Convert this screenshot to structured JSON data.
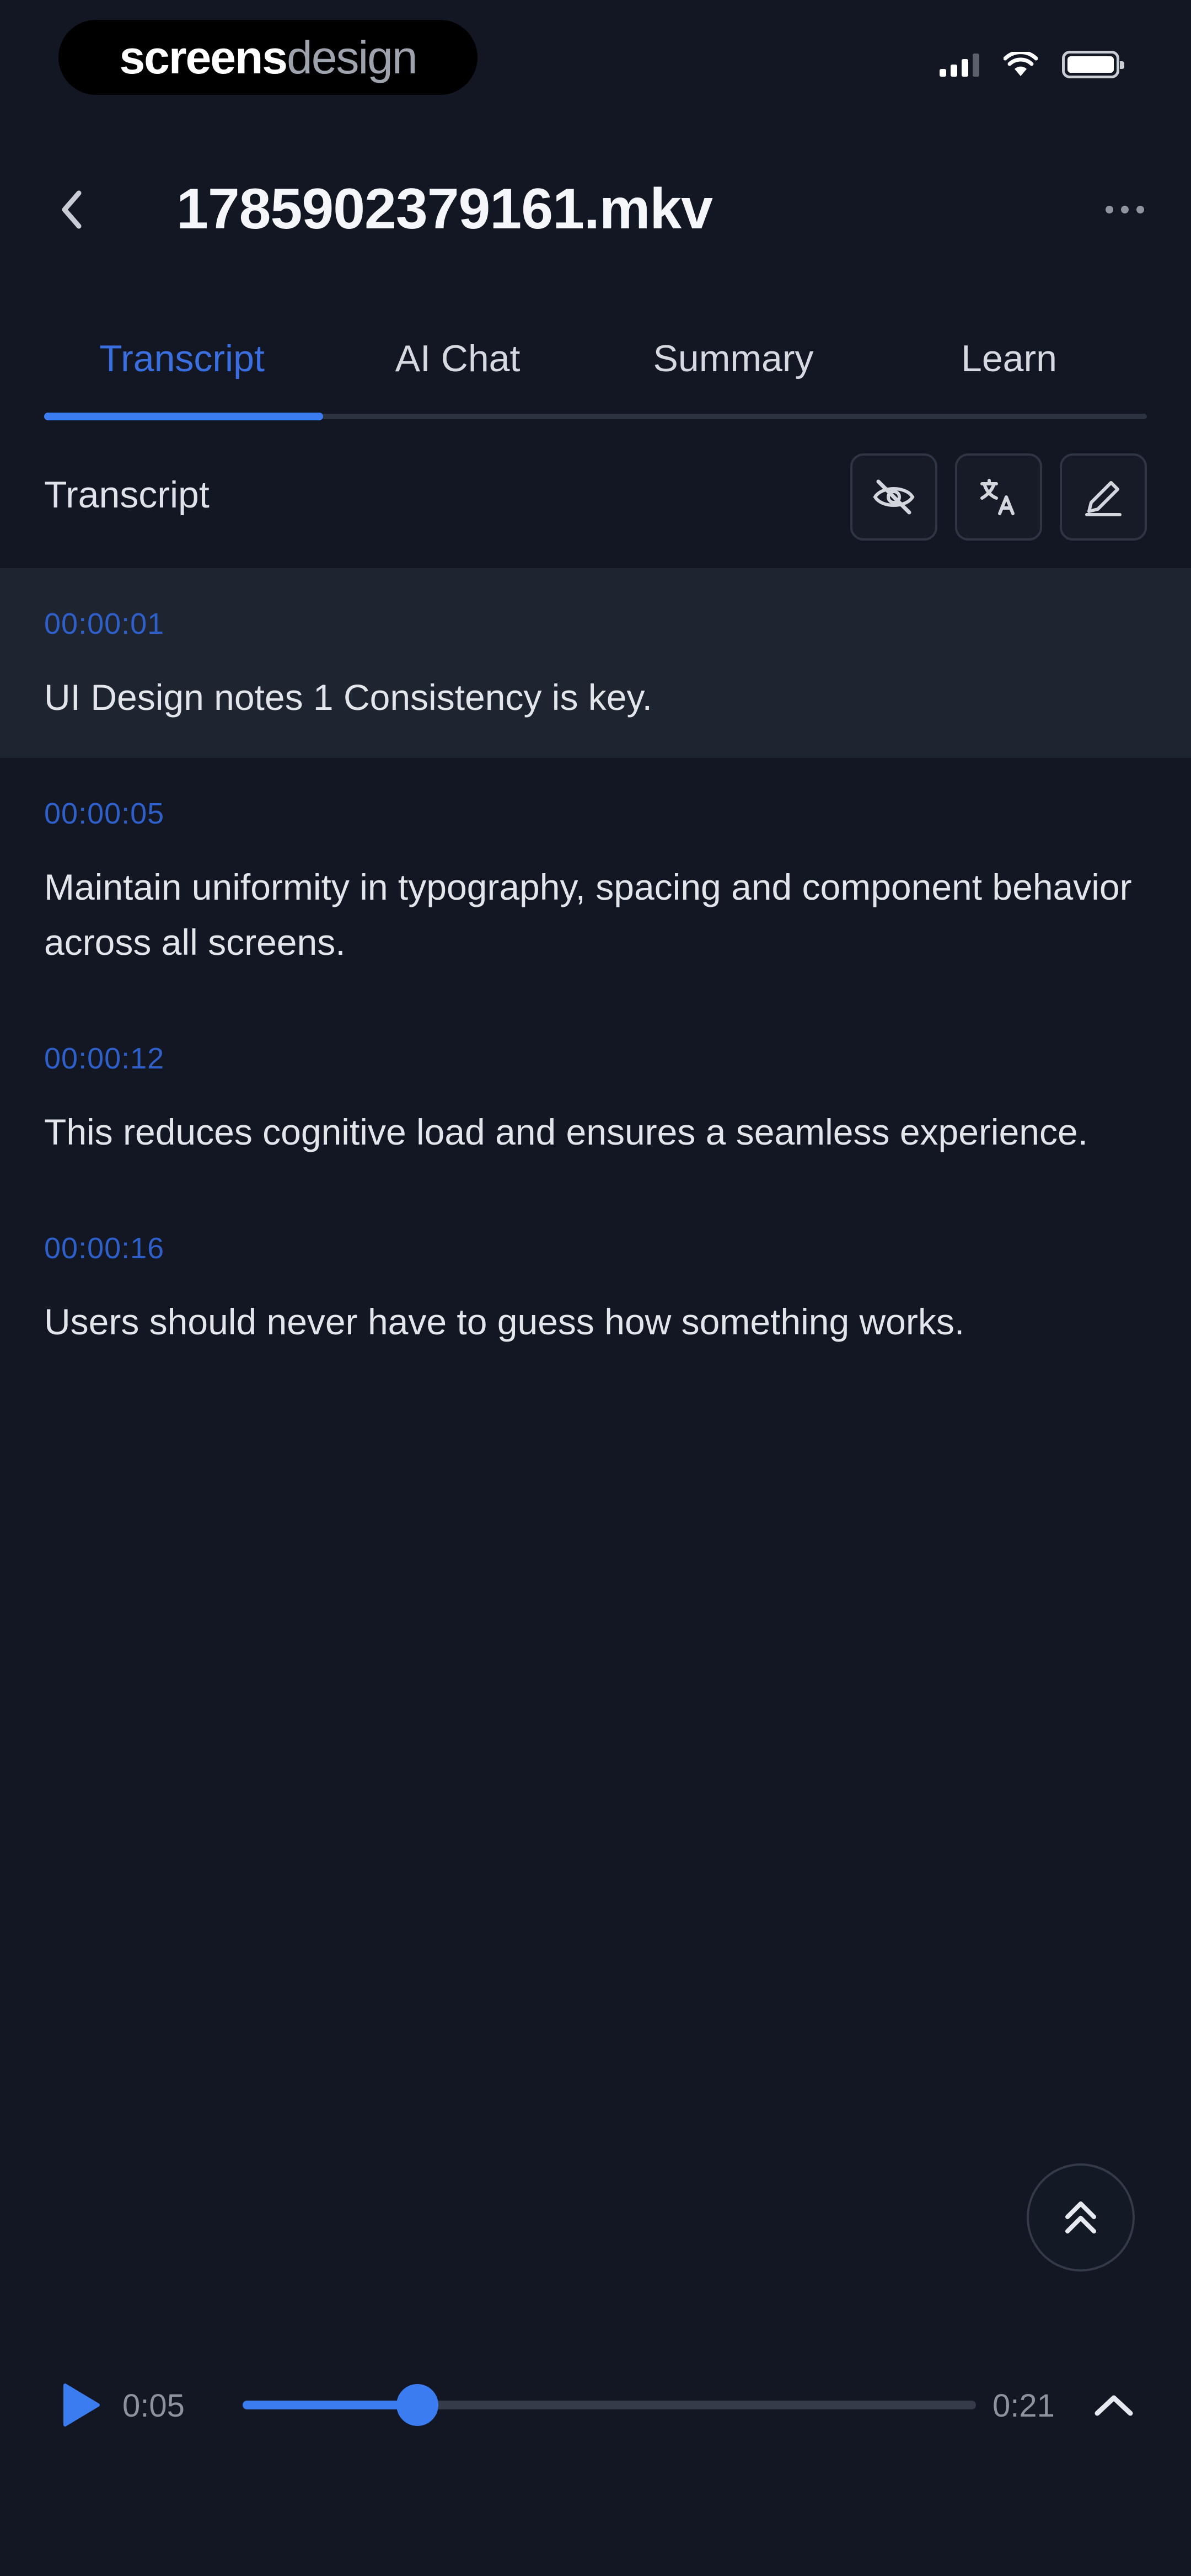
{
  "status_bar": {
    "brand_bold": "screens",
    "brand_light": "design",
    "icons": [
      "signal-icon",
      "wifi-icon",
      "battery-icon"
    ]
  },
  "header": {
    "title": "1785902379161.mkv",
    "icons": [
      "chevron-left-icon",
      "more-horizontal-icon"
    ]
  },
  "tabs": [
    {
      "label": "Transcript",
      "active": true
    },
    {
      "label": "AI Chat",
      "active": false
    },
    {
      "label": "Summary",
      "active": false
    },
    {
      "label": "Learn",
      "active": false
    }
  ],
  "section": {
    "title": "Transcript",
    "tools": [
      "eye-off-icon",
      "translate-icon",
      "edit-icon"
    ]
  },
  "transcript": [
    {
      "time": "00:00:01",
      "text": "UI Design notes 1 Consistency is key."
    },
    {
      "time": "00:00:05",
      "text": "Maintain uniformity in typography, spacing and component behavior across all screens."
    },
    {
      "time": "00:00:12",
      "text": "This reduces cognitive load and ensures a seamless experience."
    },
    {
      "time": "00:00:16",
      "text": "Users should never have to guess how something works."
    }
  ],
  "player": {
    "current_time": "0:05",
    "total_time": "0:21",
    "progress_fraction": 0.238,
    "icons": [
      "play-icon",
      "chevron-up-icon",
      "double-chevron-up-icon"
    ]
  },
  "colors": {
    "background": "#121723",
    "accent": "#3b7cf0",
    "timestamp": "#2f5fc8",
    "highlight_row": "#1e2430"
  }
}
